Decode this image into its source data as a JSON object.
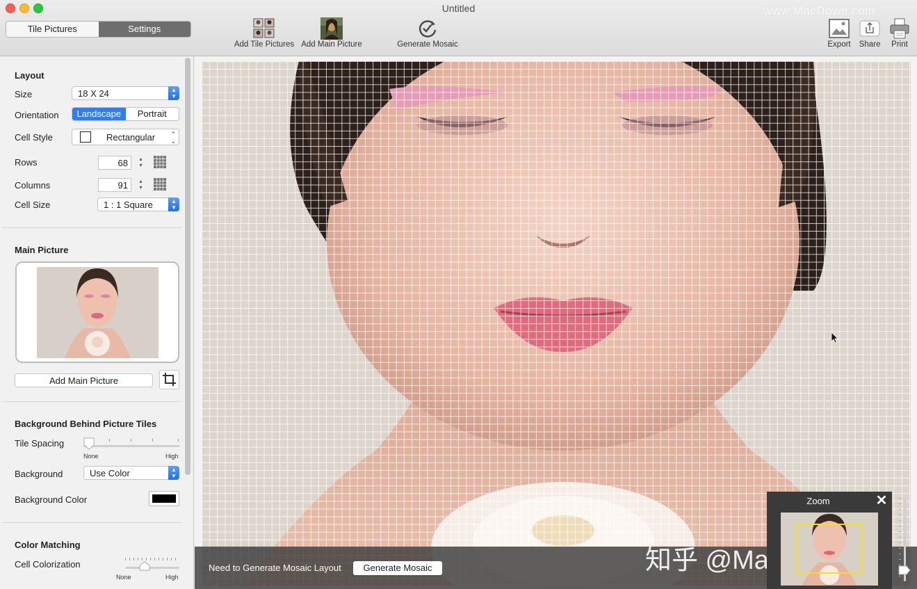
{
  "window": {
    "title": "Untitled",
    "watermark": "www.MacDown.com"
  },
  "colors": {
    "accent": "#2f7df6",
    "close": "#fc5f57",
    "minimize": "#fdbc2e",
    "zoom": "#28c840"
  },
  "mode_tabs": [
    {
      "label": "Tile Pictures",
      "active": false
    },
    {
      "label": "Settings",
      "active": true
    }
  ],
  "toolbar": {
    "add_tile_pictures": "Add Tile Pictures",
    "add_main_picture": "Add Main Picture",
    "generate_mosaic": "Generate Mosaic",
    "export": "Export",
    "share": "Share",
    "print": "Print"
  },
  "layout": {
    "heading": "Layout",
    "size_label": "Size",
    "size_value": "18 X 24",
    "orientation_label": "Orientation",
    "orientation_options": [
      "Landscape",
      "Portrait"
    ],
    "orientation_selected": "Landscape",
    "cell_style_label": "Cell Style",
    "cell_style_value": "Rectangular",
    "rows_label": "Rows",
    "rows_value": "68",
    "columns_label": "Columns",
    "columns_value": "91",
    "cell_size_label": "Cell Size",
    "cell_size_value": "1 : 1 Square"
  },
  "main_picture": {
    "heading": "Main Picture",
    "add_button": "Add Main Picture"
  },
  "background": {
    "heading": "Background Behind Picture Tiles",
    "tile_spacing_label": "Tile Spacing",
    "tile_spacing_min": "None",
    "tile_spacing_max": "High",
    "tile_spacing_level": 0,
    "background_label": "Background",
    "background_value": "Use Color",
    "background_color_label": "Background Color",
    "background_color": "#000000"
  },
  "color_matching": {
    "heading": "Color Matching",
    "cell_colorization_label": "Cell Colorization",
    "min": "None",
    "max": "High",
    "level": 0.33
  },
  "status": {
    "message": "Need to Generate Mosaic Layout",
    "button": "Generate Mosaic"
  },
  "zoom_panel": {
    "title": "Zoom"
  },
  "overlay_watermark": "知乎 @Mac精彩推荐"
}
